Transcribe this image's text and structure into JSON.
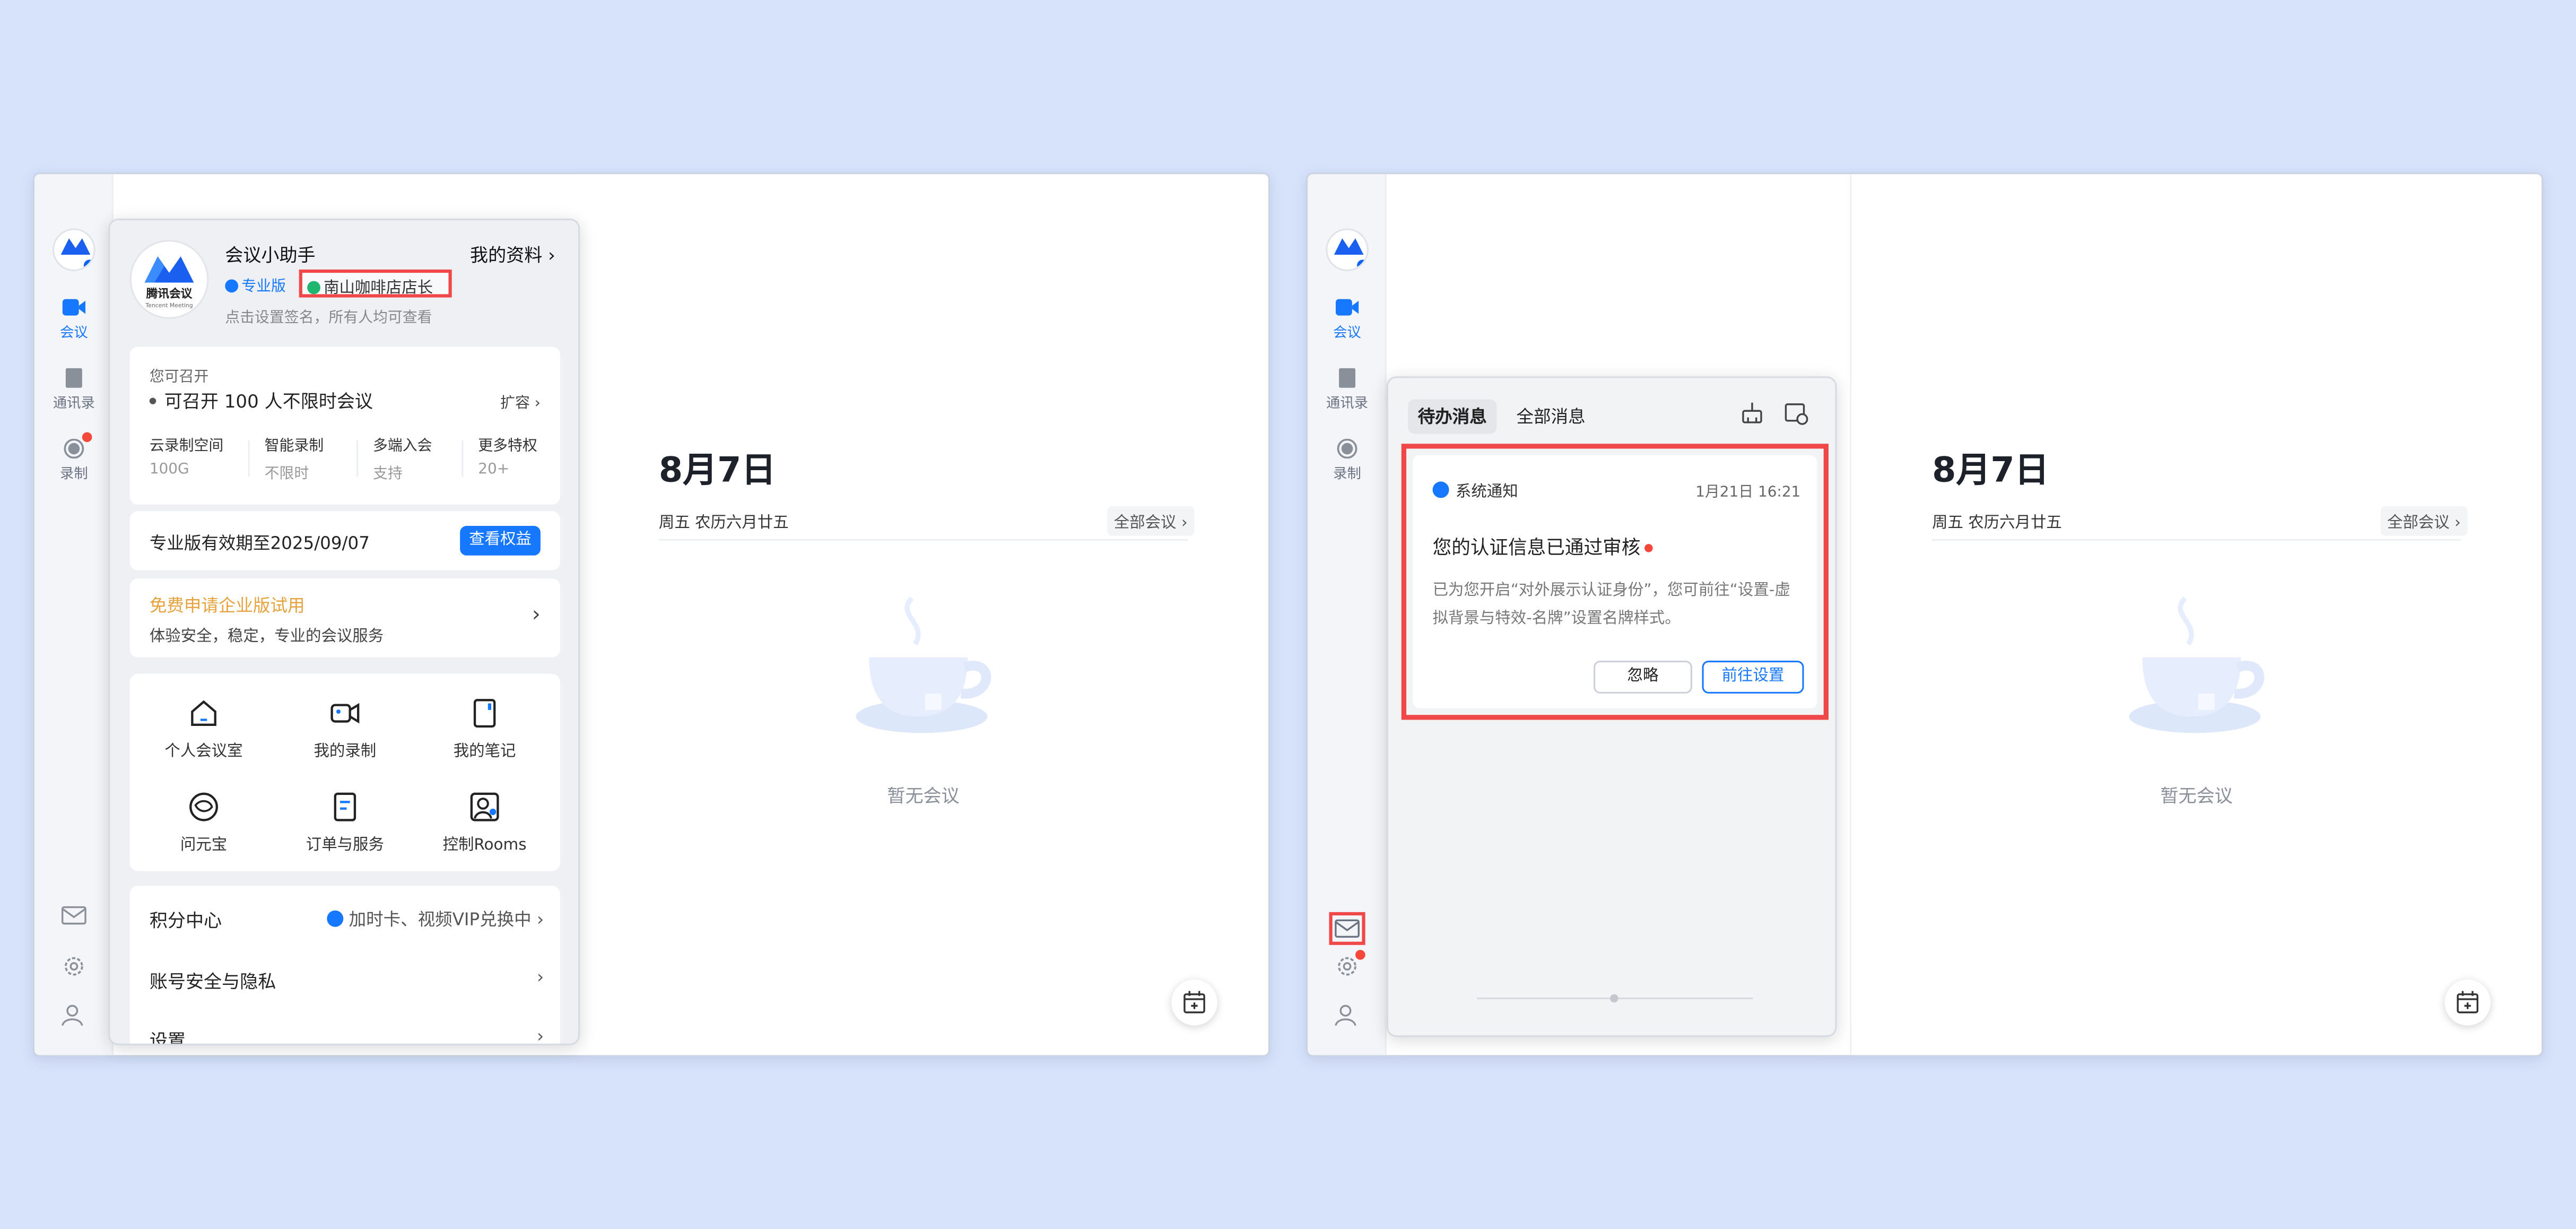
{
  "left_window": {
    "rail": {
      "items": [
        "会议",
        "通讯录",
        "录制"
      ]
    },
    "window_controls": "–  ☐  ✕",
    "profile": {
      "name": "会议小助手",
      "my_profile": "我的资料",
      "edition": "专业版",
      "cert_tag": "南山咖啡店店长",
      "signature": "点击设置签名，所有人均可查看",
      "logo_title": "腾讯会议",
      "logo_sub": "Tencent Meeting",
      "can_host_label": "您可召开",
      "can_host_value": "可召开 100 人不限时会议",
      "expand": "扩容",
      "features": [
        {
          "label": "云录制空间",
          "value": "100G"
        },
        {
          "label": "智能录制",
          "value": "不限时"
        },
        {
          "label": "多端入会",
          "value": "支持"
        },
        {
          "label": "更多特权",
          "value": "20+"
        }
      ],
      "validity": "专业版有效期至2025/09/07",
      "view_benefits": "查看权益",
      "trial_title": "免费申请企业版试用",
      "trial_sub": "体验安全，稳定，专业的会议服务",
      "tools": [
        "个人会议室",
        "我的录制",
        "我的笔记",
        "问元宝",
        "订单与服务",
        "控制Rooms"
      ],
      "points_label": "积分中心",
      "points_value": "加时卡、视频VIP兑换中",
      "security": "账号安全与隐私",
      "settings": "设置"
    },
    "main": {
      "date": "8月7日",
      "subdate": "周五 农历六月廿五",
      "all_meetings": "全部会议",
      "empty": "暂无会议"
    }
  },
  "right_window": {
    "rail": {
      "items": [
        "会议",
        "通讯录",
        "录制"
      ]
    },
    "window_controls": "–  ☐  ✕",
    "messages": {
      "tab_pending": "待办消息",
      "tab_all": "全部消息",
      "source": "系统通知",
      "time": "1月21日 16:21",
      "title": "您的认证信息已通过审核",
      "body": "已为您开启“对外展示认证身份”，您可前往“设置-虚拟背景与特效-名牌”设置名牌样式。",
      "ignore": "忽略",
      "go_settings": "前往设置"
    },
    "main": {
      "date": "8月7日",
      "subdate": "周五 农历六月廿五",
      "all_meetings": "全部会议",
      "empty": "暂无会议"
    }
  },
  "colors": {
    "background": "#d7e3fb",
    "accent": "#1677ff",
    "highlight": "#f04848"
  }
}
